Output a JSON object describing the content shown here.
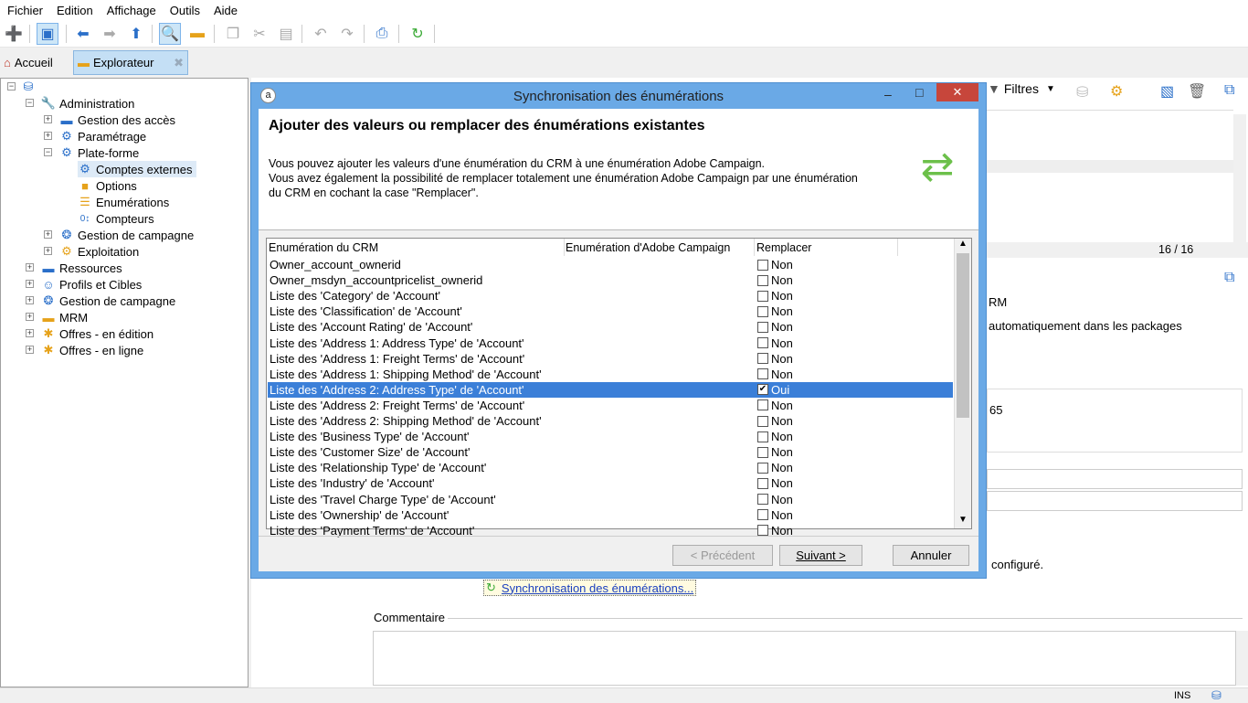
{
  "menu": [
    "Fichier",
    "Edition",
    "Affichage",
    "Outils",
    "Aide"
  ],
  "tabs": {
    "home": "Accueil",
    "explorer": "Explorateur"
  },
  "tree": [
    {
      "label": "Administration",
      "icon": "wrench-icon"
    },
    {
      "label": "Gestion des accès",
      "icon": "folder-icon"
    },
    {
      "label": "Paramétrage",
      "icon": "gears-icon"
    },
    {
      "label": "Plate-forme",
      "icon": "gears-icon"
    },
    {
      "label": "Comptes externes",
      "icon": "gears-icon"
    },
    {
      "label": "Options",
      "icon": "options-icon"
    },
    {
      "label": "Enumérations",
      "icon": "list-icon"
    },
    {
      "label": "Compteurs",
      "icon": "counter-icon"
    },
    {
      "label": "Gestion de campagne",
      "icon": "campaign-icon"
    },
    {
      "label": "Exploitation",
      "icon": "gears-icon"
    },
    {
      "label": "Ressources",
      "icon": "folder-icon"
    },
    {
      "label": "Profils et Cibles",
      "icon": "people-icon"
    },
    {
      "label": "Gestion de campagne",
      "icon": "campaign-icon"
    },
    {
      "label": "MRM",
      "icon": "folder-icon"
    },
    {
      "label": "Offres - en édition",
      "icon": "offer-icon"
    },
    {
      "label": "Offres - en ligne",
      "icon": "offer-icon"
    }
  ],
  "right": {
    "filters": "Filtres",
    "count": "16 / 16",
    "crm_text": "RM",
    "auto_text": "automatiquement dans les packages",
    "num_text": "65",
    "configured": "configuré.",
    "sync_link": "Synchronisation des énumérations...",
    "comment_label": "Commentaire",
    "status_ins": "INS"
  },
  "dialog": {
    "title": "Synchronisation des énumérations",
    "heading": "Ajouter des valeurs ou remplacer des énumérations existantes",
    "desc1": "Vous pouvez ajouter les valeurs d'une énumération du CRM à une énumération Adobe Campaign.",
    "desc2": "Vous avez également la possibilité de remplacer totalement une énumération Adobe Campaign par une énumération",
    "desc3": "du CRM en cochant la case \"Remplacer\".",
    "columns": [
      "Enumération du CRM",
      "Enumération d'Adobe Campaign",
      "Remplacer"
    ],
    "rows": [
      {
        "crm": "Owner_account_ownerid",
        "replace": "Non",
        "checked": false
      },
      {
        "crm": "Owner_msdyn_accountpricelist_ownerid",
        "replace": "Non",
        "checked": false
      },
      {
        "crm": "Liste des 'Category' de 'Account'",
        "replace": "Non",
        "checked": false
      },
      {
        "crm": "Liste des 'Classification' de 'Account'",
        "replace": "Non",
        "checked": false
      },
      {
        "crm": "Liste des 'Account Rating' de 'Account'",
        "replace": "Non",
        "checked": false
      },
      {
        "crm": "Liste des 'Address 1: Address Type' de 'Account'",
        "replace": "Non",
        "checked": false
      },
      {
        "crm": "Liste des 'Address 1: Freight Terms' de 'Account'",
        "replace": "Non",
        "checked": false
      },
      {
        "crm": "Liste des 'Address 1: Shipping Method' de 'Account'",
        "replace": "Non",
        "checked": false
      },
      {
        "crm": "Liste des 'Address 2: Address Type' de 'Account'",
        "replace": "Oui",
        "checked": true
      },
      {
        "crm": "Liste des 'Address 2: Freight Terms' de 'Account'",
        "replace": "Non",
        "checked": false
      },
      {
        "crm": "Liste des 'Address 2: Shipping Method' de 'Account'",
        "replace": "Non",
        "checked": false
      },
      {
        "crm": "Liste des 'Business Type' de 'Account'",
        "replace": "Non",
        "checked": false
      },
      {
        "crm": "Liste des 'Customer Size' de 'Account'",
        "replace": "Non",
        "checked": false
      },
      {
        "crm": "Liste des 'Relationship Type' de 'Account'",
        "replace": "Non",
        "checked": false
      },
      {
        "crm": "Liste des 'Industry' de 'Account'",
        "replace": "Non",
        "checked": false
      },
      {
        "crm": "Liste des 'Travel Charge Type' de 'Account'",
        "replace": "Non",
        "checked": false
      },
      {
        "crm": "Liste des 'Ownership' de 'Account'",
        "replace": "Non",
        "checked": false
      },
      {
        "crm": "Liste des 'Payment Terms' de 'Account'",
        "replace": "Non",
        "checked": false
      }
    ],
    "buttons": {
      "prev": "< Précédent",
      "next": "Suivant >",
      "cancel": "Annuler"
    }
  },
  "colors": {
    "accent": "#3b7fd8",
    "titlebar": "#6aa9e6",
    "close": "#c7463b"
  }
}
